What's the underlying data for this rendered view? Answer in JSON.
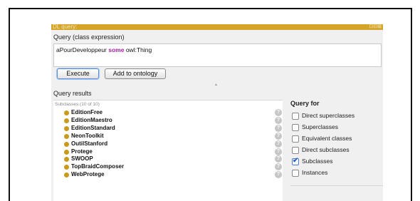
{
  "window": {
    "title": "DL query:",
    "controls": "⊡⊟⊠"
  },
  "query": {
    "label": "Query (class expression)",
    "expression_prefix": "aPourDeveloppeur ",
    "expression_keyword": "some",
    "expression_suffix": " owl:Thing"
  },
  "buttons": {
    "execute": "Execute",
    "add_to_ontology": "Add to ontology"
  },
  "results": {
    "label": "Query results",
    "subclasses_header": "Subclasses (10 of 10)",
    "items": [
      "EditionFree",
      "EditionMaestro",
      "EditionStandard",
      "NeonToolkit",
      "OutilStanford",
      "Protege",
      "SWOOP",
      "TopBraidComposer",
      "WebProtege"
    ],
    "help_glyph": "?"
  },
  "query_for": {
    "label": "Query for",
    "options": [
      {
        "label": "Direct superclasses",
        "checked": false
      },
      {
        "label": "Superclasses",
        "checked": false
      },
      {
        "label": "Equivalent classes",
        "checked": false
      },
      {
        "label": "Direct subclasses",
        "checked": false
      },
      {
        "label": "Subclasses",
        "checked": true
      },
      {
        "label": "Instances",
        "checked": false
      }
    ]
  },
  "colors": {
    "titlebar": "#d4a42a",
    "keyword": "#a21fa2",
    "bullet": "#c99a1c"
  }
}
